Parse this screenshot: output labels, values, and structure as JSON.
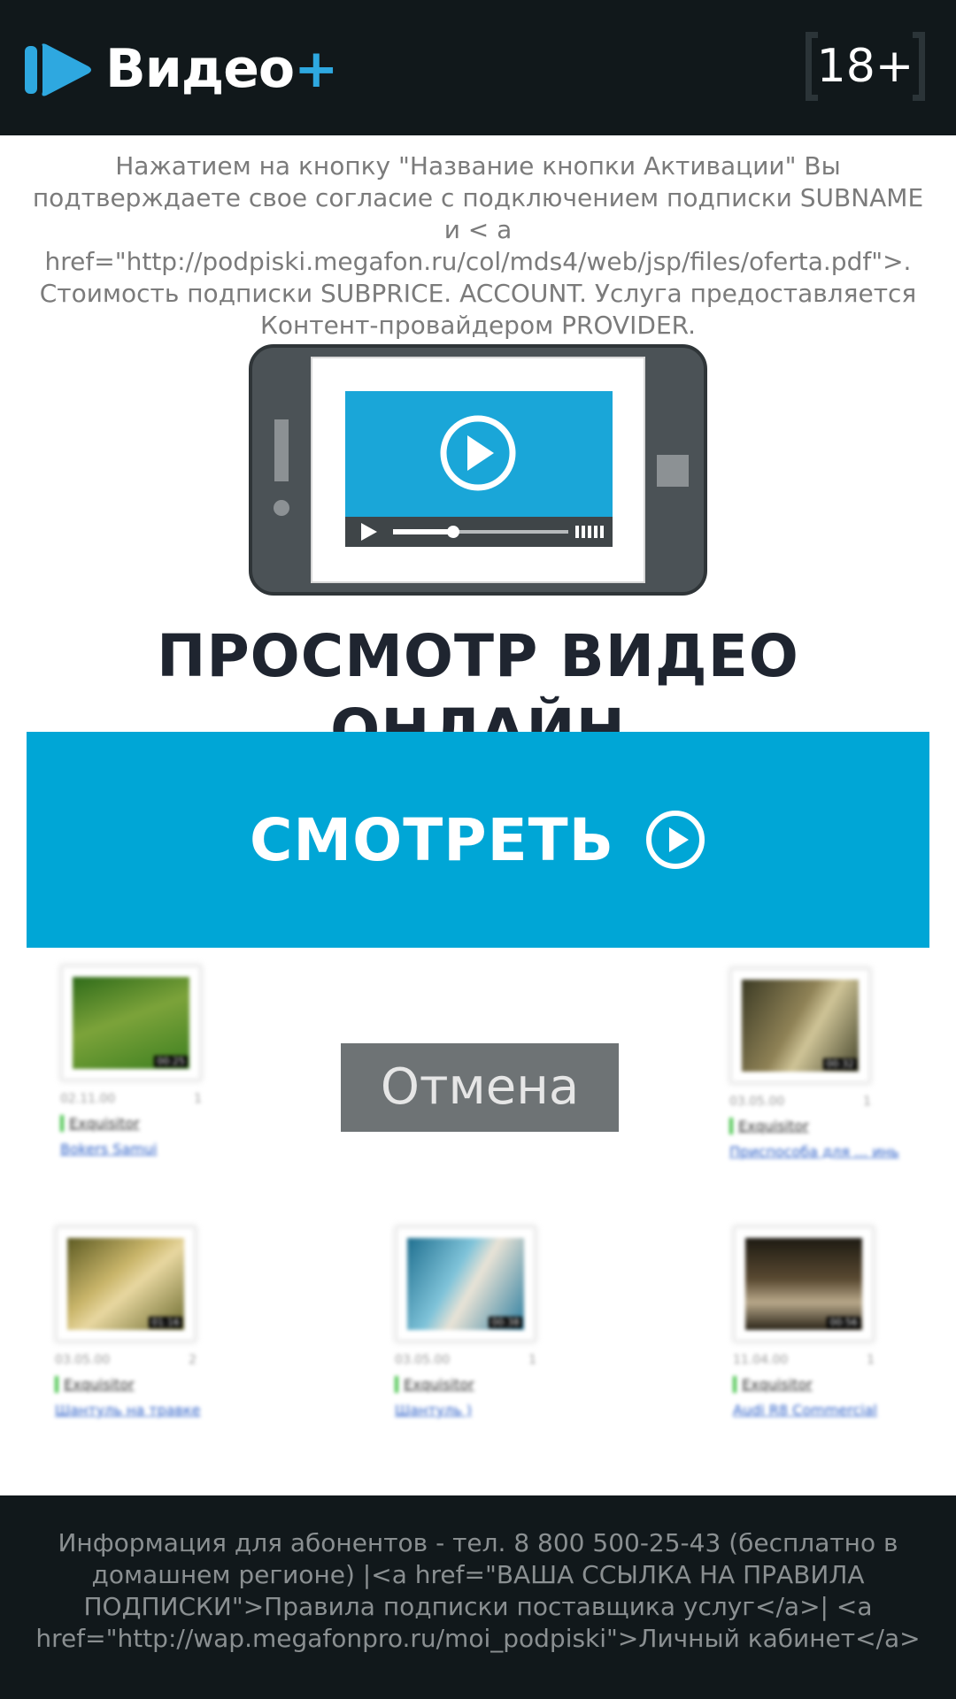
{
  "header": {
    "logo_text": "Видео",
    "logo_plus": "+",
    "age_rating": "18+"
  },
  "disclaimer": "Нажатием на кнопку \"Название кнопки Активации\" Вы подтверждаете свое согласие с подключением подписки SUBNAME и < a href=\"http://podpiski.megafon.ru/col/mds4/web/jsp/files/oferta.pdf\">. Стоимость подписки SUBPRICE. ACCOUNT. Услуга предоставляется Контент-провайдером PROVIDER.",
  "headline": "ПРОСМОТР ВИДЕО ОНЛАЙН",
  "watch_button": {
    "label": "СМОТРЕТЬ",
    "icon": "play-circle-icon"
  },
  "cancel_button": {
    "label": "Отмена"
  },
  "thumbnails": [
    {
      "duration": "00:25",
      "date": "02.11.00",
      "views": "1",
      "author": "Exquisitor",
      "title": "Bokers Samui"
    },
    {
      "duration": "00:32",
      "date": "03.05.00",
      "views": "1",
      "author": "Exquisitor",
      "title": "Приспособа для ... инь"
    },
    {
      "duration": "01:16",
      "date": "03.05.00",
      "views": "2",
      "author": "Exquisitor",
      "title": "Шантуль на травке"
    },
    {
      "duration": "00:38",
      "date": "03.05.00",
      "views": "1",
      "author": "Exquisitor",
      "title": "Шантуль )"
    },
    {
      "duration": "00:56",
      "date": "11.04.00",
      "views": "1",
      "author": "Exquisitor",
      "title": "Audi R8 Commercial"
    }
  ],
  "footer": {
    "text": "Информация для абонентов - тел. 8 800 500-25-43 (бесплатно в домашнем регионе) |<a href=\"ВАША ССЫЛКА НА ПРАВИЛА ПОДПИСКИ\">Правила подписки поставщика услуг</a>| <a href=\"http://wap.megafonpro.ru/moi_podpiski\">Личный кабинет</a>"
  },
  "colors": {
    "header_bg": "#11181b",
    "accent": "#00a6d6",
    "logo_plus": "#2ea8e0",
    "cancel_bg": "#6e7375",
    "headline": "#1f2530"
  }
}
